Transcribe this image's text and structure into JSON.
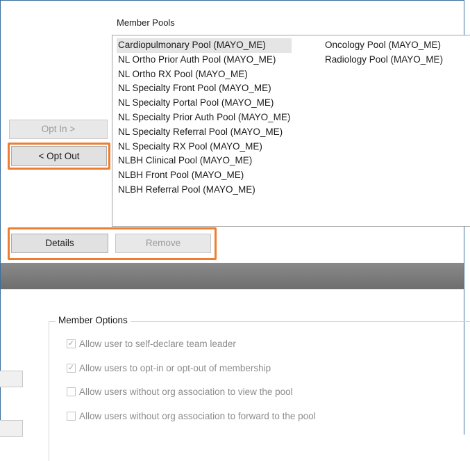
{
  "member_pools": {
    "label": "Member Pools",
    "column1": [
      "Cardiopulmonary Pool (MAYO_ME)",
      "NL Ortho Prior Auth Pool (MAYO_ME)",
      "NL Ortho RX Pool (MAYO_ME)",
      "NL Specialty Front Pool (MAYO_ME)",
      "NL Specialty Portal Pool (MAYO_ME)",
      "NL Specialty Prior Auth Pool (MAYO_ME)",
      "NL Specialty Referral Pool (MAYO_ME)",
      "NL Specialty RX Pool (MAYO_ME)",
      "NLBH Clinical Pool (MAYO_ME)",
      "NLBH Front Pool (MAYO_ME)",
      "NLBH Referral Pool (MAYO_ME)"
    ],
    "column2": [
      "Oncology Pool (MAYO_ME)",
      "Radiology Pool (MAYO_ME)"
    ]
  },
  "buttons": {
    "opt_in": "Opt In >",
    "opt_out": "< Opt Out",
    "details": "Details",
    "remove": "Remove"
  },
  "member_options": {
    "title": "Member Options",
    "options": [
      {
        "label": "Allow user to self-declare team leader",
        "checked": true
      },
      {
        "label": "Allow users to opt-in or opt-out of membership",
        "checked": true
      },
      {
        "label": "Allow users without org association to view the pool",
        "checked": false
      },
      {
        "label": "Allow users without org association to forward to the pool",
        "checked": false
      }
    ]
  },
  "colors": {
    "highlight": "#ed7d31",
    "separator_bar": "#7a7a7a"
  }
}
